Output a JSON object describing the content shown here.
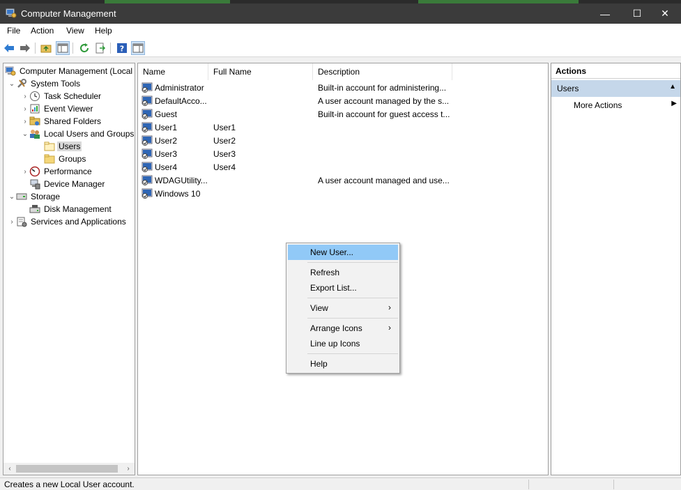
{
  "window": {
    "title": "Computer Management",
    "minimize_glyph": "—",
    "maximize_glyph": "☐",
    "close_glyph": "✕"
  },
  "menu": [
    "File",
    "Action",
    "View",
    "Help"
  ],
  "toolbar_icons": [
    "back-icon",
    "forward-icon",
    "folder-up-icon",
    "show-hide-tree-icon",
    "refresh-icon",
    "export-list-icon",
    "help-icon",
    "show-hide-action-pane-icon"
  ],
  "tree": [
    {
      "label": "Computer Management (Local",
      "icon": "computer-management-icon",
      "expander": ""
    },
    {
      "label": "System Tools",
      "icon": "system-tools-icon",
      "expander": "expanded"
    },
    {
      "label": "Task Scheduler",
      "icon": "task-scheduler-icon",
      "expander": "collapsed"
    },
    {
      "label": "Event Viewer",
      "icon": "event-viewer-icon",
      "expander": "collapsed"
    },
    {
      "label": "Shared Folders",
      "icon": "shared-folders-icon",
      "expander": "collapsed"
    },
    {
      "label": "Local Users and Groups",
      "icon": "local-users-groups-icon",
      "expander": "expanded"
    },
    {
      "label": "Users",
      "icon": "folder-icon",
      "expander": "",
      "selected": true
    },
    {
      "label": "Groups",
      "icon": "folder-icon",
      "expander": ""
    },
    {
      "label": "Performance",
      "icon": "performance-icon",
      "expander": "collapsed"
    },
    {
      "label": "Device Manager",
      "icon": "device-manager-icon",
      "expander": ""
    },
    {
      "label": "Storage",
      "icon": "storage-icon",
      "expander": "expanded"
    },
    {
      "label": "Disk Management",
      "icon": "disk-management-icon",
      "expander": ""
    },
    {
      "label": "Services and Applications",
      "icon": "services-applications-icon",
      "expander": "collapsed"
    }
  ],
  "list": {
    "columns": [
      "Name",
      "Full Name",
      "Description"
    ],
    "rows": [
      {
        "name": "Administrator",
        "full_name": "",
        "description": "Built-in account for administering..."
      },
      {
        "name": "DefaultAcco...",
        "full_name": "",
        "description": "A user account managed by the s..."
      },
      {
        "name": "Guest",
        "full_name": "",
        "description": "Built-in account for guest access t..."
      },
      {
        "name": "User1",
        "full_name": "User1",
        "description": ""
      },
      {
        "name": "User2",
        "full_name": "User2",
        "description": ""
      },
      {
        "name": "User3",
        "full_name": "User3",
        "description": ""
      },
      {
        "name": "User4",
        "full_name": "User4",
        "description": ""
      },
      {
        "name": "WDAGUtility...",
        "full_name": "",
        "description": "A user account managed and use..."
      },
      {
        "name": "Windows 10",
        "full_name": "",
        "description": ""
      }
    ]
  },
  "actions": {
    "header": "Actions",
    "section": "Users",
    "items": [
      "More Actions"
    ]
  },
  "context_menu": {
    "items": [
      {
        "label": "New User...",
        "highlighted": true,
        "submenu": false
      },
      {
        "label": "Refresh",
        "submenu": false
      },
      {
        "label": "Export List...",
        "submenu": false
      },
      {
        "label": "View",
        "submenu": true
      },
      {
        "label": "Arrange Icons",
        "submenu": true
      },
      {
        "label": "Line up Icons",
        "submenu": false
      },
      {
        "label": "Help",
        "submenu": false
      }
    ],
    "submenu_glyph": "›"
  },
  "status": {
    "text": "Creates a new Local User account."
  },
  "colors": {
    "titlebar": "#3b3b3b",
    "selection_highlight": "#91c9f7",
    "action_section": "#c5d7ea"
  }
}
